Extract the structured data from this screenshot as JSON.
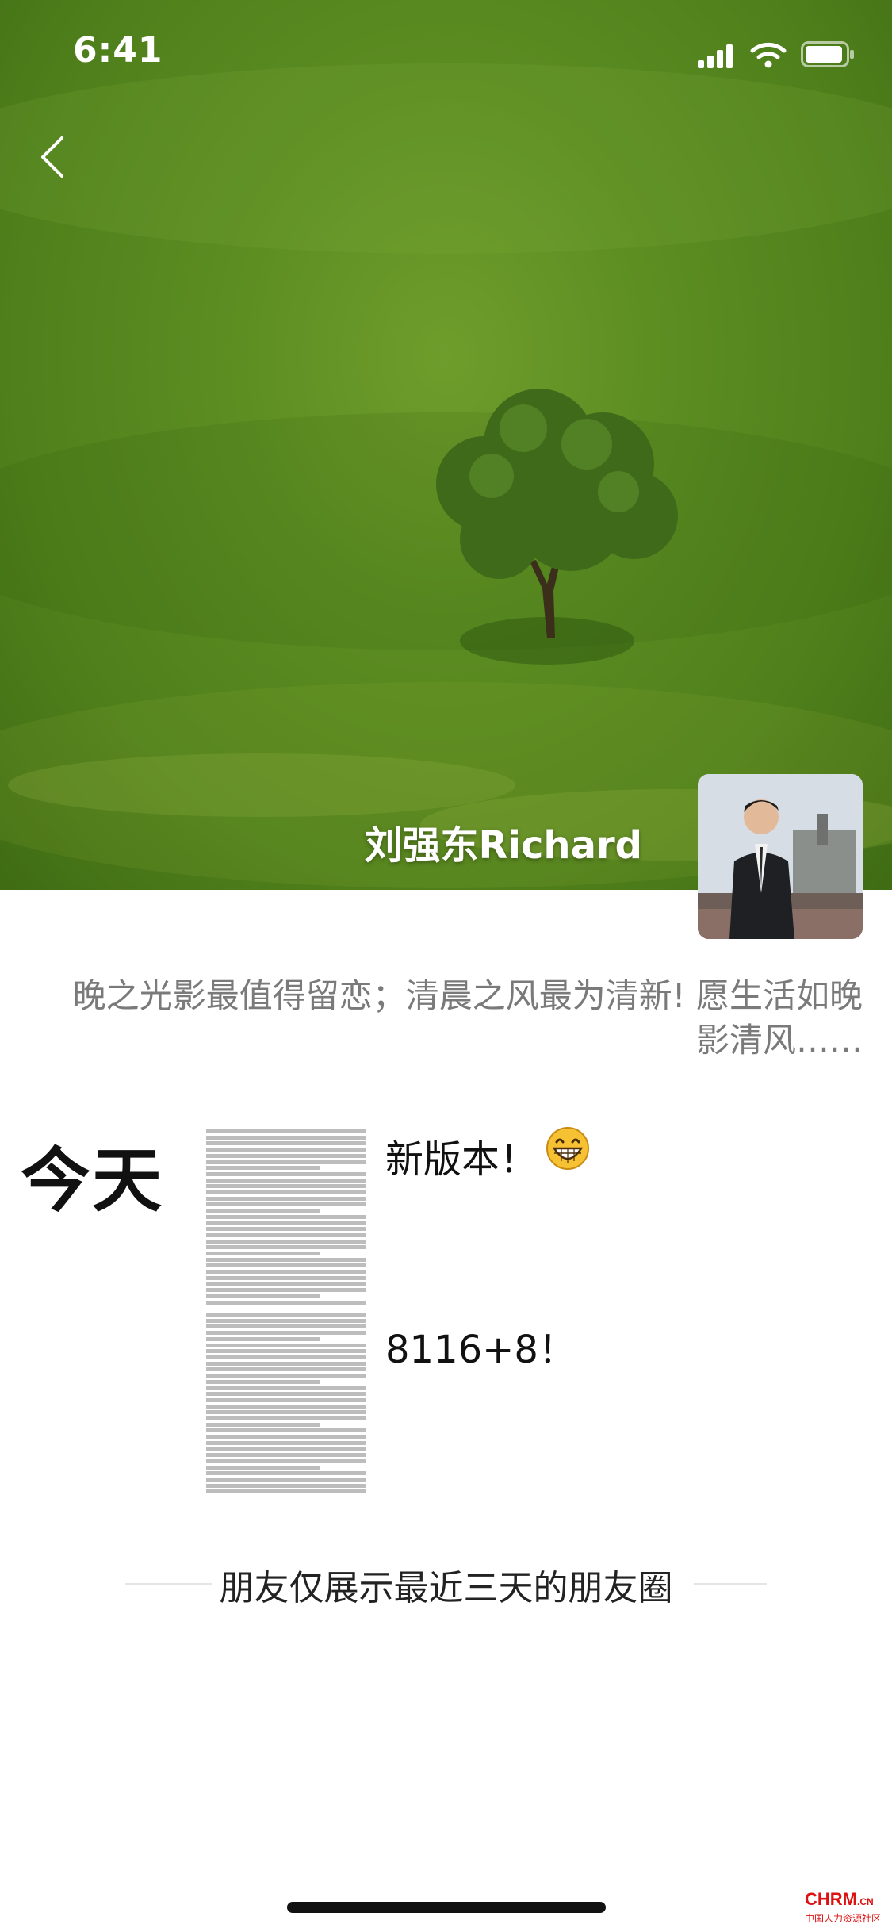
{
  "status_bar": {
    "time": "6:41"
  },
  "profile": {
    "name": "刘强东Richard",
    "signature": "晚之光影最值得留恋；清晨之风最为清新! 愿生活如晚影清风……"
  },
  "moments": [
    {
      "day_label": "今天",
      "posts": [
        {
          "text": "新版本！",
          "emoji_icon": "grin-emoji-icon"
        },
        {
          "text": "8116+8！"
        }
      ]
    }
  ],
  "footer": {
    "end_text": "朋友仅展示最近三天的朋友圈"
  },
  "watermark": {
    "logo": "CHRM",
    "suffix": ".CN",
    "subtitle": "中国人力资源社区"
  },
  "colors": {
    "grass": "#5c8d22",
    "signature_text": "#7a7a7a"
  }
}
